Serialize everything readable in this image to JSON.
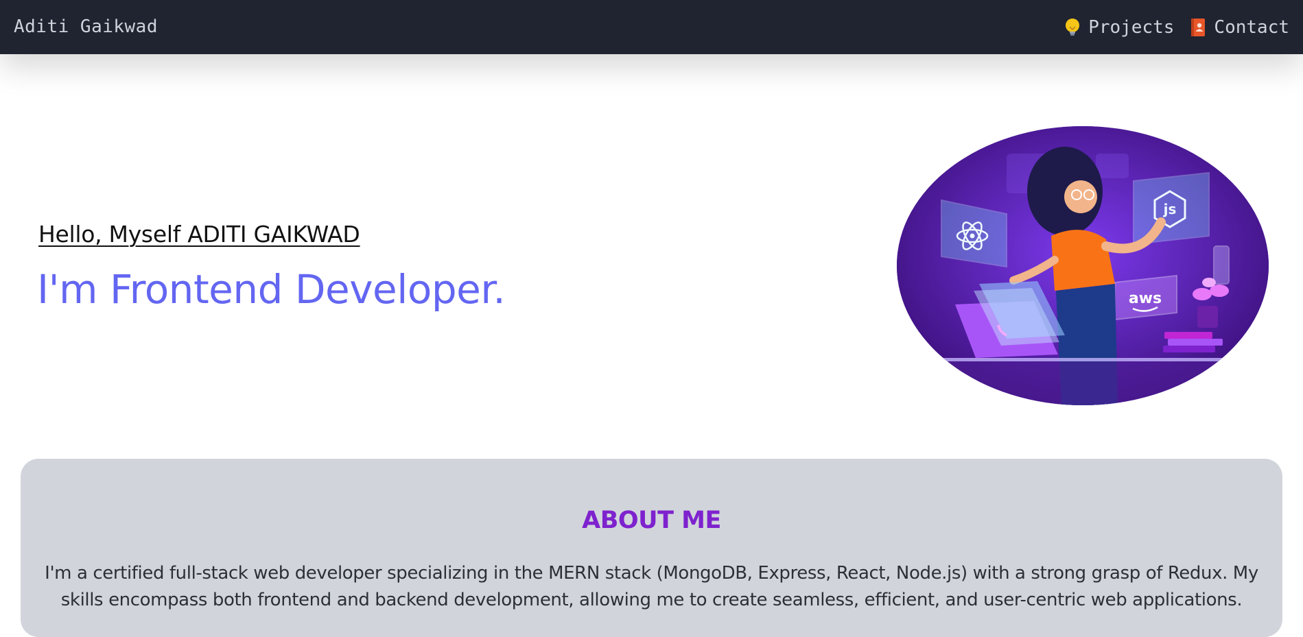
{
  "navbar": {
    "brand": "Aditi Gaikwad",
    "links": [
      {
        "label": "Projects",
        "icon": "lightbulb-icon"
      },
      {
        "label": "Contact",
        "icon": "contact-book-icon"
      }
    ]
  },
  "hero": {
    "greeting": "Hello, Myself ADITI GAIKWAD",
    "role": "I'm Frontend Developer.",
    "image_tags": {
      "aws": "aws",
      "node": "js"
    }
  },
  "about": {
    "title": "ABOUT ME",
    "text": "I'm a certified full-stack web developer specializing in the MERN stack (MongoDB, Express, React, Node.js) with a strong grasp of Redux. My skills encompass both frontend and backend development, allowing me to create seamless, efficient, and user-centric web applications."
  },
  "colors": {
    "navbar_bg": "#1f2430",
    "accent_indigo": "#6366f1",
    "accent_purple": "#7e22ce",
    "about_bg": "#d1d5db"
  }
}
